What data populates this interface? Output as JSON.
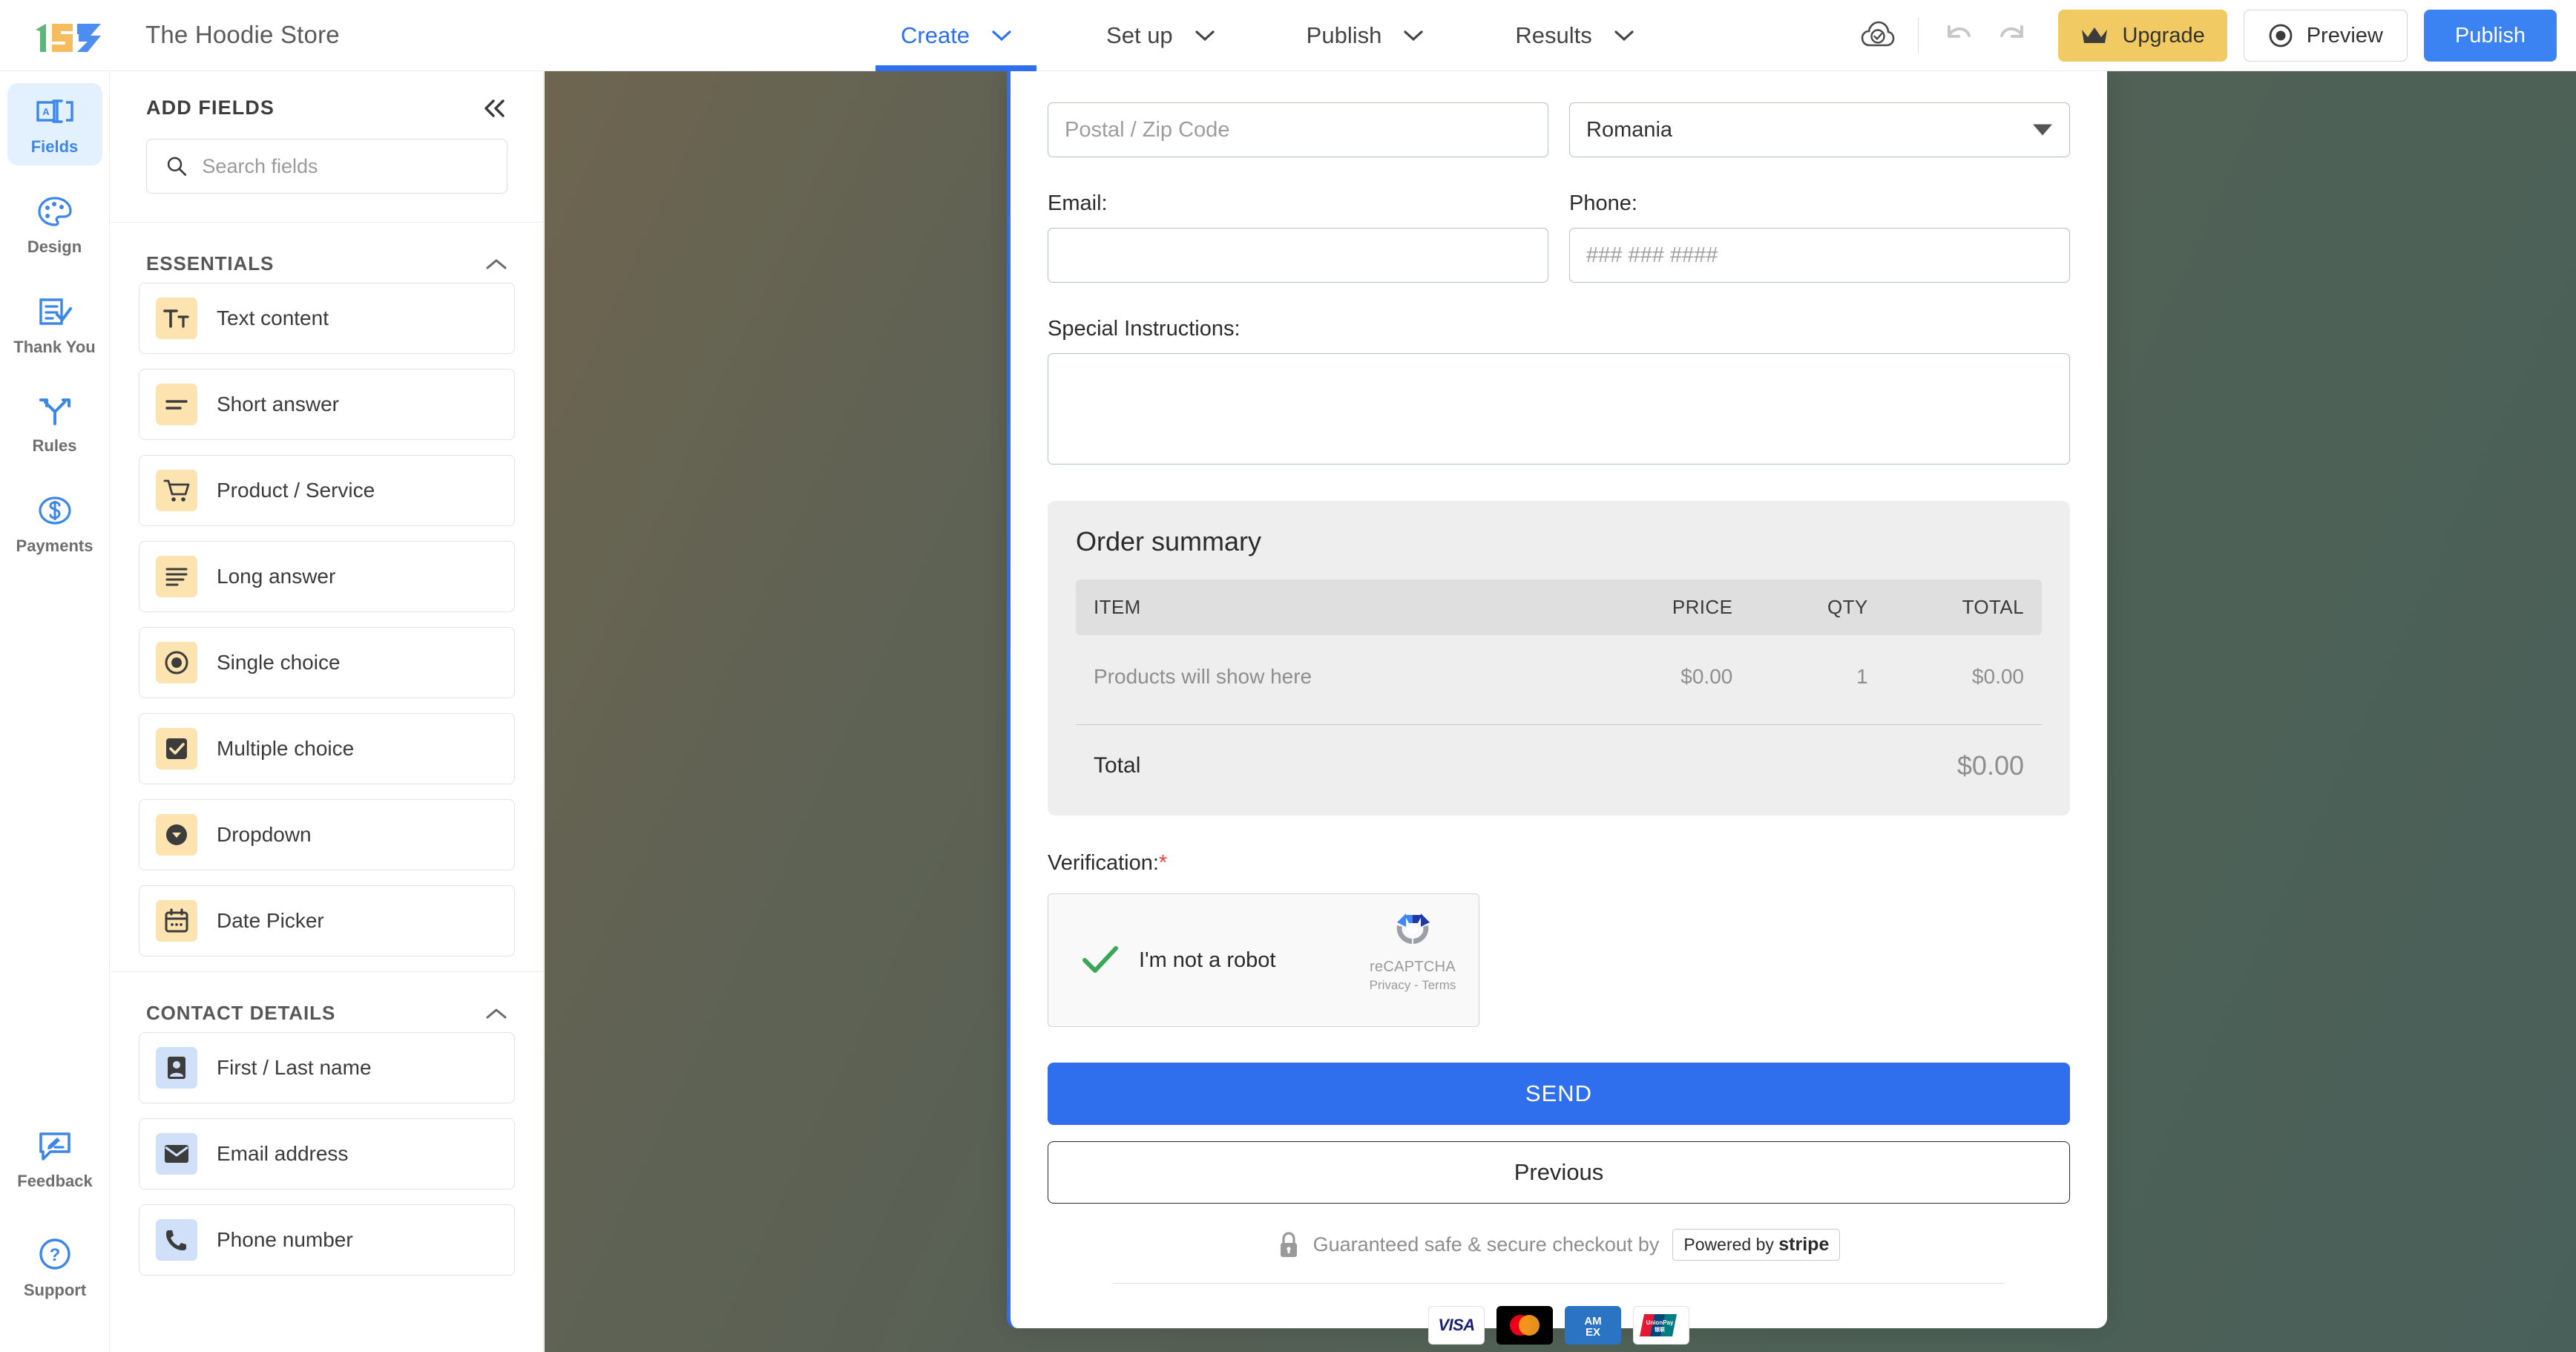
{
  "header": {
    "brand_title": "The Hoodie Store",
    "logo_alt": "123 Form Builder",
    "nav": [
      {
        "label": "Create",
        "active": true
      },
      {
        "label": "Set up",
        "active": false
      },
      {
        "label": "Publish",
        "active": false
      },
      {
        "label": "Results",
        "active": false
      }
    ],
    "upgrade_label": "Upgrade",
    "preview_label": "Preview",
    "publish_label": "Publish"
  },
  "rail": {
    "items": [
      {
        "label": "Fields",
        "icon": "fields-icon",
        "active": true
      },
      {
        "label": "Design",
        "icon": "palette-icon",
        "active": false
      },
      {
        "label": "Thank You",
        "icon": "thankyou-icon",
        "active": false
      },
      {
        "label": "Rules",
        "icon": "rules-icon",
        "active": false
      },
      {
        "label": "Payments",
        "icon": "payments-icon",
        "active": false
      }
    ],
    "bottom_items": [
      {
        "label": "Feedback",
        "icon": "feedback-icon"
      },
      {
        "label": "Support",
        "icon": "support-icon"
      }
    ]
  },
  "panel": {
    "title": "ADD FIELDS",
    "search_placeholder": "Search fields",
    "search_value": "",
    "groups": [
      {
        "title": "ESSENTIALS",
        "expanded": true,
        "items": [
          {
            "label": "Text content",
            "icon": "text-content-icon",
            "tone": "amber"
          },
          {
            "label": "Short answer",
            "icon": "short-answer-icon",
            "tone": "amber"
          },
          {
            "label": "Product / Service",
            "icon": "cart-icon",
            "tone": "amber"
          },
          {
            "label": "Long answer",
            "icon": "long-answer-icon",
            "tone": "amber"
          },
          {
            "label": "Single choice",
            "icon": "radio-icon",
            "tone": "amber"
          },
          {
            "label": "Multiple choice",
            "icon": "checkbox-icon",
            "tone": "amber"
          },
          {
            "label": "Dropdown",
            "icon": "dropdown-icon",
            "tone": "amber"
          },
          {
            "label": "Date Picker",
            "icon": "calendar-icon",
            "tone": "amber"
          }
        ]
      },
      {
        "title": "CONTACT DETAILS",
        "expanded": true,
        "items": [
          {
            "label": "First / Last name",
            "icon": "person-icon",
            "tone": "blue"
          },
          {
            "label": "Email address",
            "icon": "envelope-icon",
            "tone": "blue"
          },
          {
            "label": "Phone number",
            "icon": "phone-icon",
            "tone": "blue"
          }
        ]
      }
    ]
  },
  "form": {
    "postal_placeholder": "Postal / Zip Code",
    "postal_value": "",
    "country_value": "Romania",
    "email_label": "Email:",
    "email_value": "",
    "phone_label": "Phone:",
    "phone_placeholder": "### ### ####",
    "phone_value": "",
    "instructions_label": "Special Instructions:",
    "instructions_value": "",
    "order_summary": {
      "title": "Order summary",
      "columns": [
        "ITEM",
        "PRICE",
        "QTY",
        "TOTAL"
      ],
      "rows": [
        {
          "item": "Products will show here",
          "price": "$0.00",
          "qty": "1",
          "total": "$0.00"
        }
      ],
      "total_label": "Total",
      "total_value": "$0.00"
    },
    "verification_label": "Verification:",
    "verification_required_mark": "*",
    "captcha": {
      "checkbox_label": "I'm not a robot",
      "brand": "reCAPTCHA",
      "terms": "Privacy - Terms"
    },
    "send_label": "SEND",
    "previous_label": "Previous",
    "secure_text": "Guaranteed safe & secure checkout by",
    "stripe_prefix": "Powered by",
    "stripe_name": "stripe",
    "payment_cards": [
      "VISA",
      "Mastercard",
      "AMEX",
      "UnionPay"
    ]
  },
  "colors": {
    "accent_blue": "#2f6fee",
    "upgrade_yellow": "#f2ca63",
    "icon_amber": "#fce3b0",
    "icon_blue": "#cfe0f8",
    "required_red": "#e8453c"
  }
}
